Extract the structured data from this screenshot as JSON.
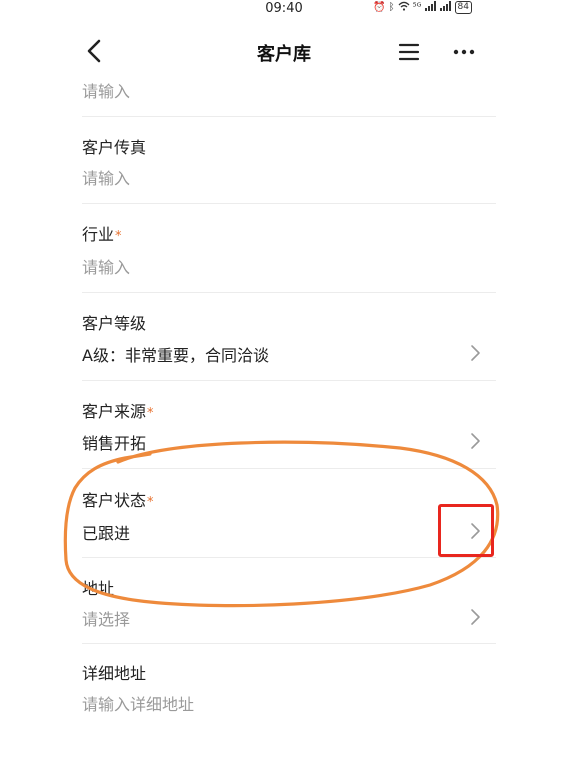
{
  "status_bar": {
    "time": "09:40",
    "network": "⁵ᴳ",
    "battery": "84"
  },
  "header": {
    "title": "客户库"
  },
  "first_value": "请输入",
  "fields": [
    {
      "label": "客户传真",
      "required": false,
      "value": "请输入",
      "placeholder": true,
      "chevron": false
    },
    {
      "label": "行业",
      "required": true,
      "value": "请输入",
      "placeholder": true,
      "chevron": false
    },
    {
      "label": "客户等级",
      "required": false,
      "value": "A级：非常重要，合同洽谈",
      "placeholder": false,
      "chevron": true
    },
    {
      "label": "客户来源",
      "required": true,
      "value": "销售开拓",
      "placeholder": false,
      "chevron": true
    },
    {
      "label": "客户状态",
      "required": true,
      "value": "已跟进",
      "placeholder": false,
      "chevron": true
    },
    {
      "label": "地址",
      "required": false,
      "value": "请选择",
      "placeholder": true,
      "chevron": true
    },
    {
      "label": "详细地址",
      "required": false,
      "value": "请输入详细地址",
      "placeholder": true,
      "chevron": false
    }
  ],
  "required_mark": "*",
  "colors": {
    "required": "#e6702e",
    "annotation_ellipse": "#ee8a3c",
    "annotation_box": "#e8261e",
    "placeholder": "#9a9a9a"
  }
}
